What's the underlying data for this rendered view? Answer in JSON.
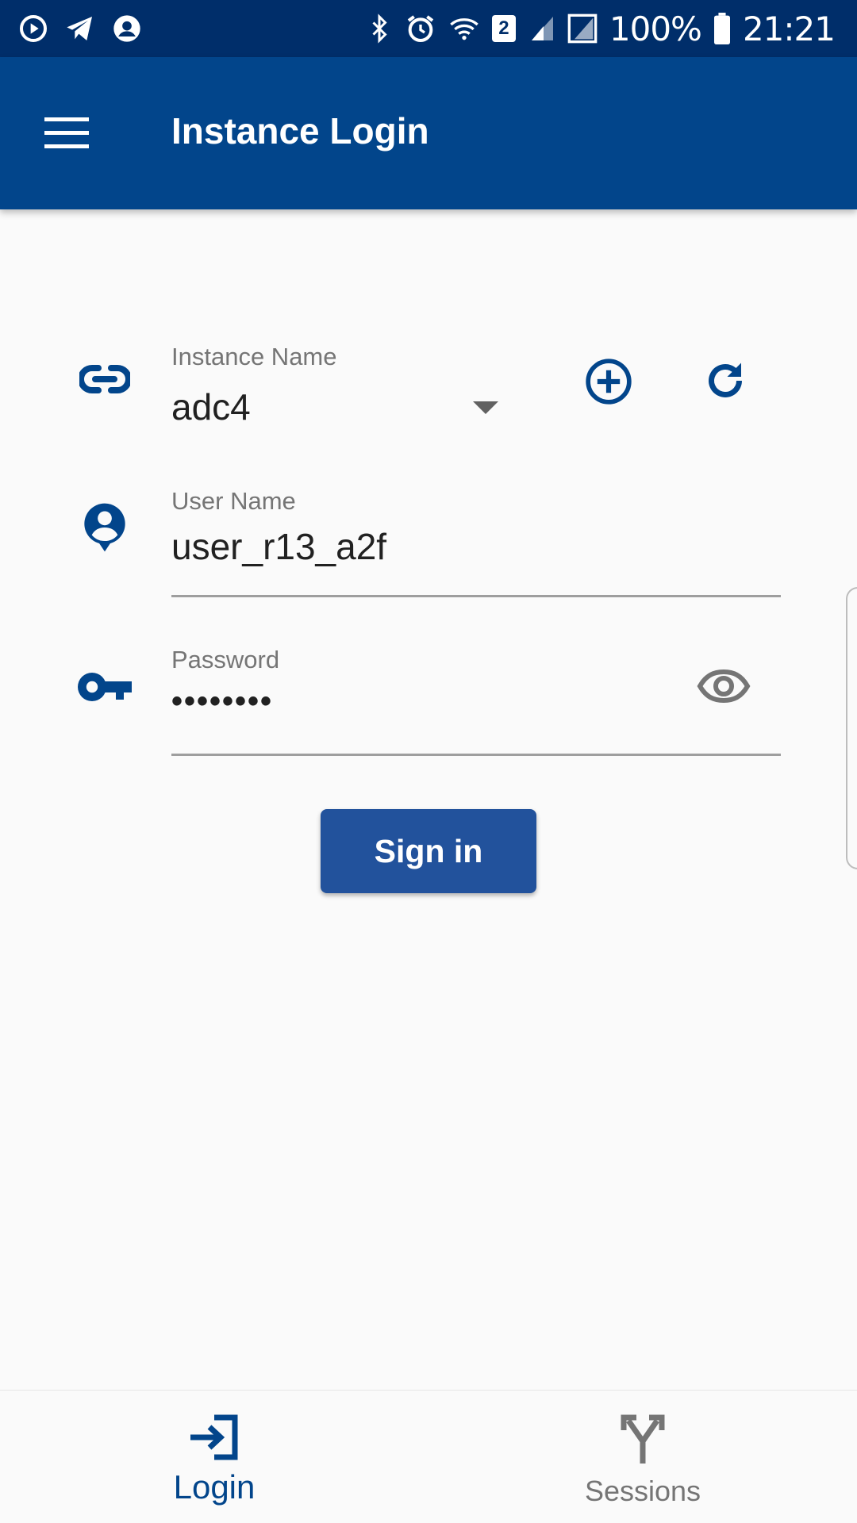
{
  "status_bar": {
    "battery": "100%",
    "time": "21:21",
    "badge": "2"
  },
  "app_bar": {
    "title": "Instance Login"
  },
  "form": {
    "instance": {
      "label": "Instance Name",
      "value": "adc4"
    },
    "username": {
      "label": "User Name",
      "value": "user_r13_a2f"
    },
    "password": {
      "label": "Password",
      "value": "••••••••"
    },
    "sign_in_label": "Sign in"
  },
  "bottom_nav": {
    "items": [
      {
        "label": "Login",
        "active": true
      },
      {
        "label": "Sessions",
        "active": false
      }
    ]
  },
  "colors": {
    "status_bar": "#002e6a",
    "app_bar": "#02458b",
    "primary": "#02458b",
    "button": "#22529c"
  }
}
